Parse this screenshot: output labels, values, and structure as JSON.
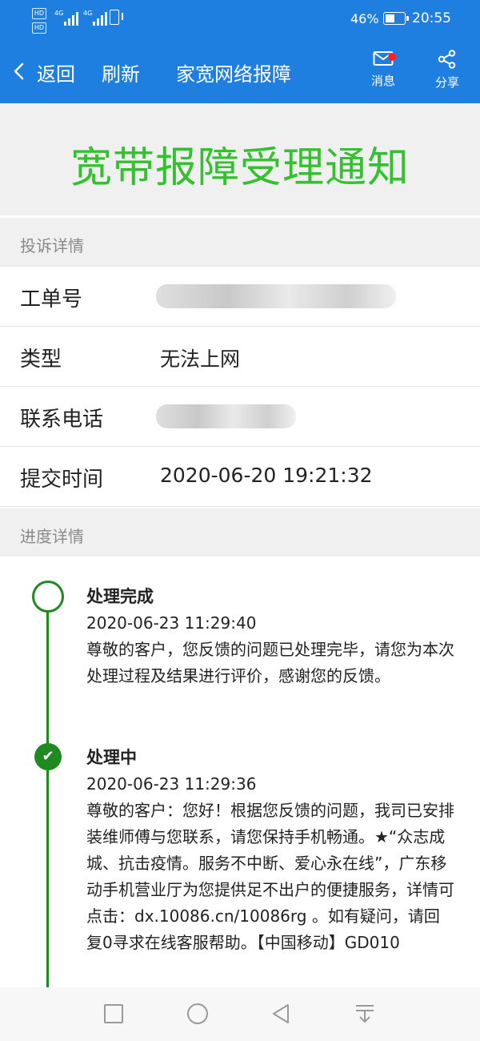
{
  "status_bar": {
    "battery_percent": "46%",
    "time": "20:55",
    "network_label_1": "4G",
    "network_label_2": "4G",
    "hd_1": "HD",
    "hd_2": "HD"
  },
  "nav": {
    "back_label": "返回",
    "refresh_label": "刷新",
    "page_title": "家宽网络报障",
    "messages_label": "消息",
    "share_label": "分享",
    "unread_dot_color": "#ff1f1f"
  },
  "header": {
    "title": "宽带报障受理通知",
    "title_color": "#35c02f"
  },
  "complaint": {
    "section_title": "投诉详情",
    "rows": [
      {
        "key": "工单号",
        "value": "",
        "redacted": true
      },
      {
        "key": "类型",
        "value": "无法上网",
        "redacted": false
      },
      {
        "key": "联系电话",
        "value": "",
        "redacted": true
      },
      {
        "key": "提交时间",
        "value": "2020-06-20 19:21:32",
        "redacted": false
      }
    ]
  },
  "progress": {
    "section_title": "进度详情",
    "timeline_color": "#1f8a1f",
    "entries": [
      {
        "status": "处理完成",
        "time": "2020-06-23 11:29:40",
        "message": "尊敬的客户，您反馈的问题已处理完毕，请您为本次处理过程及结果进行评价，感谢您的反馈。",
        "icon": "open-circle-icon"
      },
      {
        "status": "处理中",
        "time": "2020-06-23 11:29:36",
        "message": "尊敬的客户：您好！根据您反馈的问题，我司已安排装维师傅与您联系，请您保持手机畅通。★“众志成城、抗击疫情。服务不中断、爱心永在线”，广东移动手机营业厅为您提供足不出户的便捷服务，详情可点击：dx.10086.cn/10086rg 。如有疑问，请回复0寻求在线客服帮助。【中国移动】GD010",
        "icon": "check-circle-icon"
      }
    ]
  },
  "system_nav": {
    "icons": [
      "recent-apps-icon",
      "home-icon",
      "back-icon",
      "notification-shade-icon"
    ]
  }
}
